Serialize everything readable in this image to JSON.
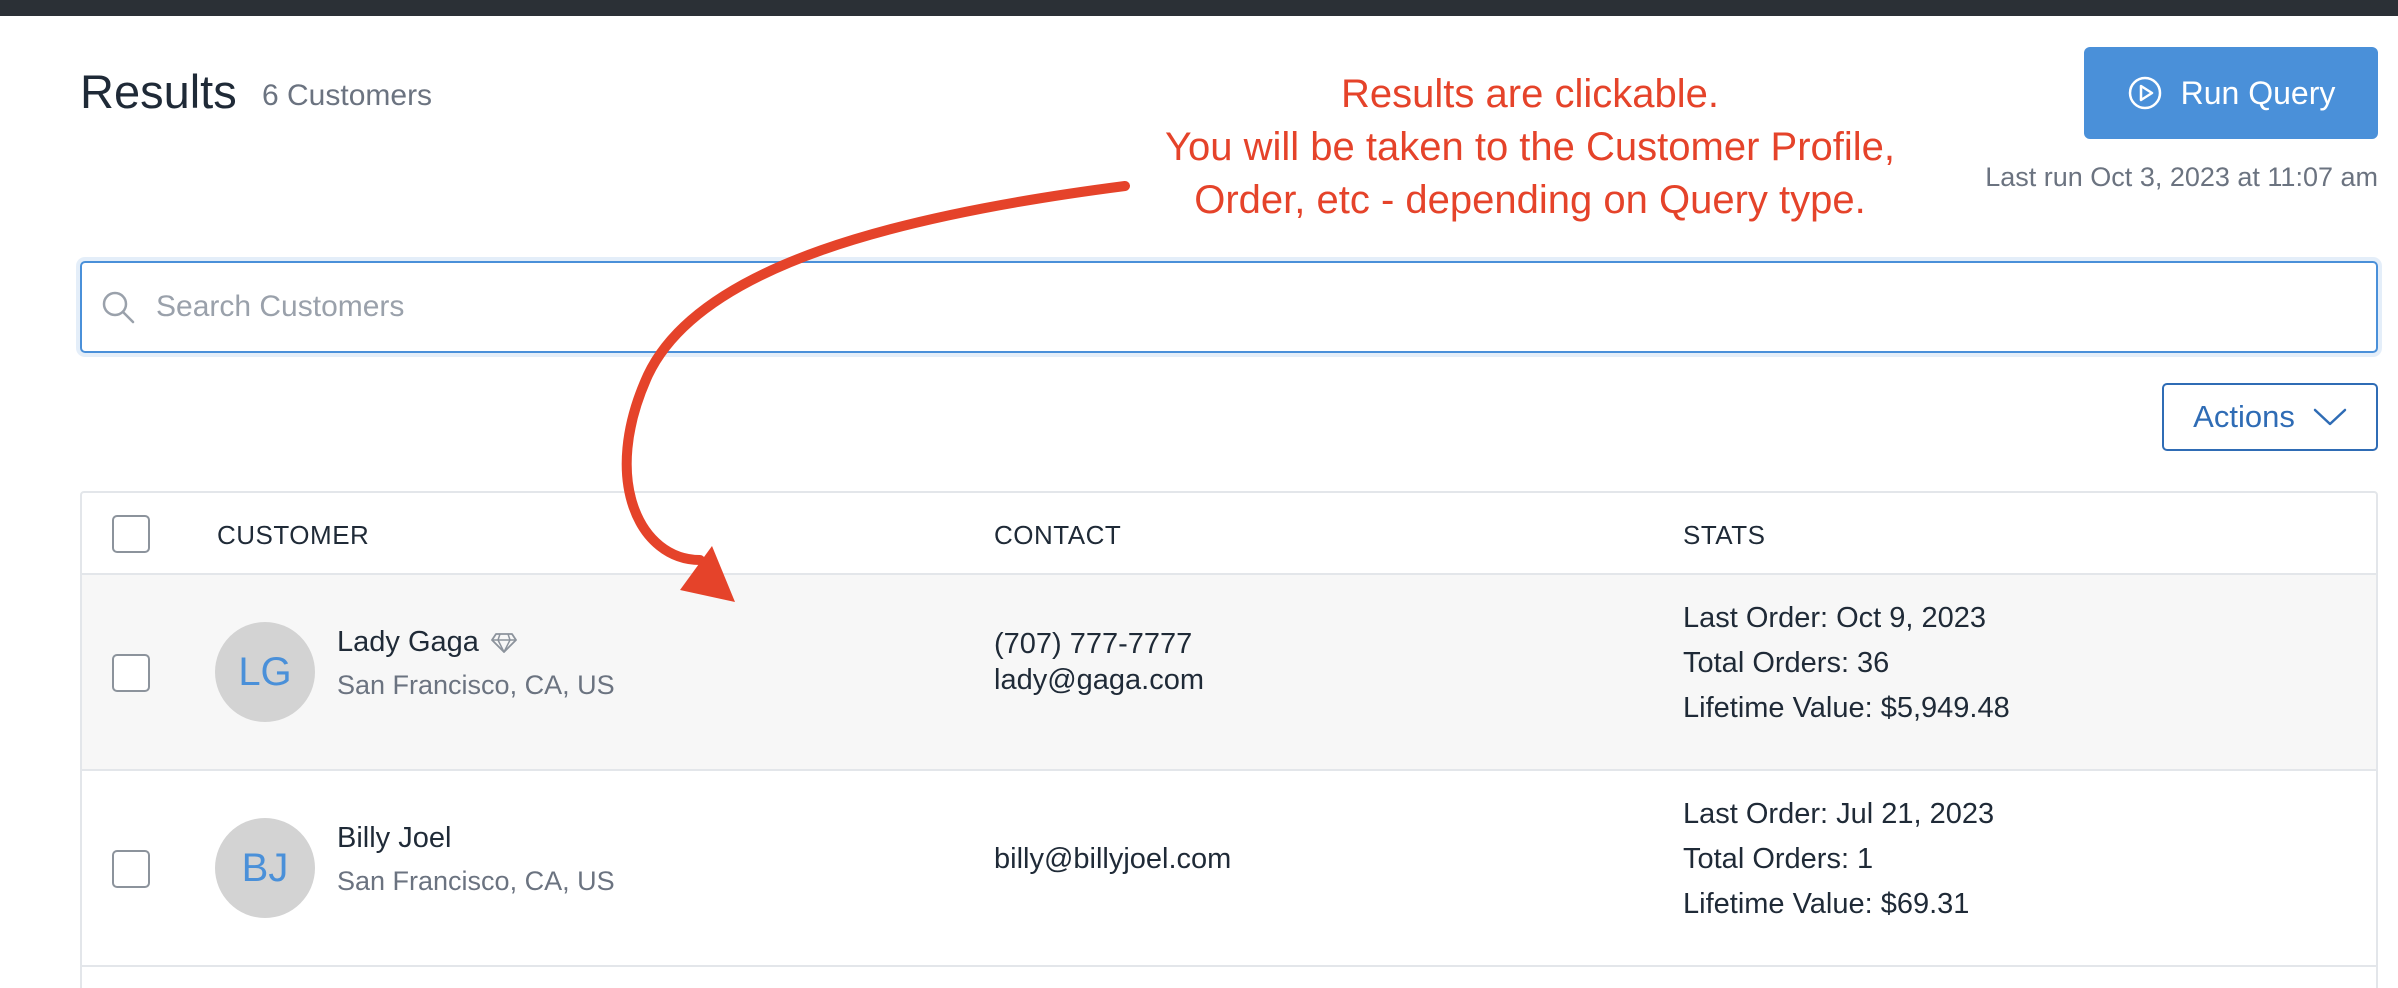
{
  "header": {
    "title": "Results",
    "count": "6 Customers",
    "run_query_label": "Run Query",
    "last_run": "Last run Oct 3, 2023 at 11:07 am"
  },
  "annotation": {
    "lines": [
      "Results are clickable.",
      "You will be taken to the Customer Profile,",
      "Order, etc - depending on Query type."
    ],
    "color": "#e5432a"
  },
  "search": {
    "placeholder": "Search Customers",
    "value": ""
  },
  "actions": {
    "label": "Actions"
  },
  "table": {
    "columns": [
      "CUSTOMER",
      "CONTACT",
      "STATS"
    ],
    "rows": [
      {
        "initials": "LG",
        "name": "Lady Gaga",
        "vip_icon": "diamond-icon",
        "location": "San Francisco, CA, US",
        "contact": [
          "(707) 777-7777",
          "lady@gaga.com"
        ],
        "stats": [
          "Last Order: Oct 9, 2023",
          "Total Orders: 36",
          "Lifetime Value: $5,949.48"
        ]
      },
      {
        "initials": "BJ",
        "name": "Billy Joel",
        "location": "San Francisco, CA, US",
        "contact": [
          "billy@billyjoel.com"
        ],
        "stats": [
          "Last Order: Jul 21, 2023",
          "Total Orders: 1",
          "Lifetime Value: $69.31"
        ]
      }
    ]
  },
  "colors": {
    "accent": "#4a90d9",
    "actions_border": "#2f6cb5",
    "annotation": "#e5432a"
  }
}
